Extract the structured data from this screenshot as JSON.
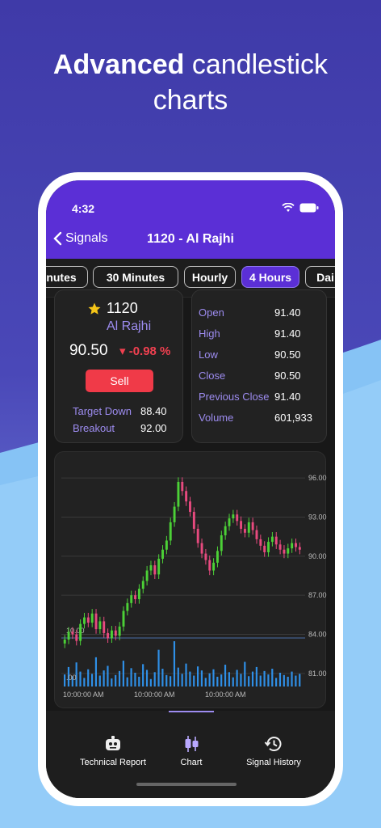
{
  "headline": {
    "bold": "Advanced",
    "rest": " candlestick",
    "line2": "charts"
  },
  "status": {
    "time": "4:32"
  },
  "nav": {
    "back_label": "Signals",
    "title": "1120 - Al Rajhi"
  },
  "tabs": [
    "nutes",
    "30 Minutes",
    "Hourly",
    "4 Hours",
    "Dai"
  ],
  "active_tab": "4 Hours",
  "signal": {
    "symbol": "1120",
    "name": "Al Rajhi",
    "price": "90.50",
    "change": "▾ -0.98 %",
    "sell_label": "Sell",
    "target_down_label": "Target Down",
    "target_down_value": "88.40",
    "breakout_label": "Breakout",
    "breakout_value": "92.00"
  },
  "ohlc": [
    {
      "label": "Open",
      "value": "91.40"
    },
    {
      "label": "High",
      "value": "91.40"
    },
    {
      "label": "Low",
      "value": "90.50"
    },
    {
      "label": "Close",
      "value": "90.50"
    },
    {
      "label": "Previous Close",
      "value": "91.40"
    },
    {
      "label": "Volume",
      "value": "601,933"
    }
  ],
  "chart_data": {
    "type": "candlestick",
    "price_axis_labels": [
      "96.00",
      "93.00",
      "90.00",
      "87.00",
      "84.00",
      "81.00"
    ],
    "volume_axis_labels": [
      "10.00",
      ".00"
    ],
    "x_tick_labels": [
      "10:00:00 AM",
      "10:00:00 AM",
      "10:00:00 AM"
    ],
    "ylim": [
      80,
      97
    ],
    "closes": [
      83.6,
      84.2,
      84.0,
      83.5,
      84.8,
      85.3,
      84.9,
      85.6,
      84.4,
      85.0,
      84.1,
      83.7,
      84.3,
      83.9,
      84.6,
      85.8,
      86.4,
      87.0,
      86.7,
      87.5,
      88.1,
      88.9,
      89.3,
      88.6,
      89.8,
      90.5,
      91.2,
      92.6,
      93.8,
      95.7,
      95.0,
      94.2,
      93.4,
      92.1,
      91.0,
      90.2,
      89.7,
      88.9,
      89.5,
      90.4,
      91.6,
      92.3,
      92.9,
      93.2,
      92.7,
      92.1,
      91.8,
      92.6,
      92.0,
      91.3,
      90.8,
      90.3,
      91.1,
      91.5,
      90.9,
      90.5,
      90.2,
      90.6,
      91.0,
      90.7,
      90.5
    ],
    "volumes": [
      2.1,
      3.4,
      1.8,
      4.2,
      2.6,
      1.5,
      3.0,
      2.2,
      5.1,
      1.9,
      2.8,
      3.6,
      1.4,
      2.0,
      2.7,
      4.5,
      1.6,
      3.2,
      2.4,
      1.7,
      3.9,
      2.9,
      1.3,
      2.5,
      6.4,
      3.1,
      2.0,
      1.8,
      7.9,
      3.3,
      2.2,
      4.0,
      2.6,
      1.9,
      3.5,
      2.8,
      1.5,
      2.3,
      3.0,
      1.7,
      2.1,
      3.8,
      2.5,
      1.6,
      2.9,
      2.2,
      4.3,
      1.8,
      2.6,
      3.4,
      1.9,
      2.7,
      2.1,
      3.1,
      1.5,
      2.4,
      2.0,
      1.7,
      2.6,
      1.9,
      2.2
    ]
  },
  "bottom_nav": [
    {
      "label": "Technical Report",
      "icon": "robot-icon"
    },
    {
      "label": "Chart",
      "icon": "candlestick-icon"
    },
    {
      "label": "Signal History",
      "icon": "history-icon"
    }
  ],
  "colors": {
    "accent": "#5b2fd6",
    "up": "#4cd137",
    "down": "#e84a7f",
    "volume": "#2f8fe6",
    "sell": "#f03a48"
  }
}
